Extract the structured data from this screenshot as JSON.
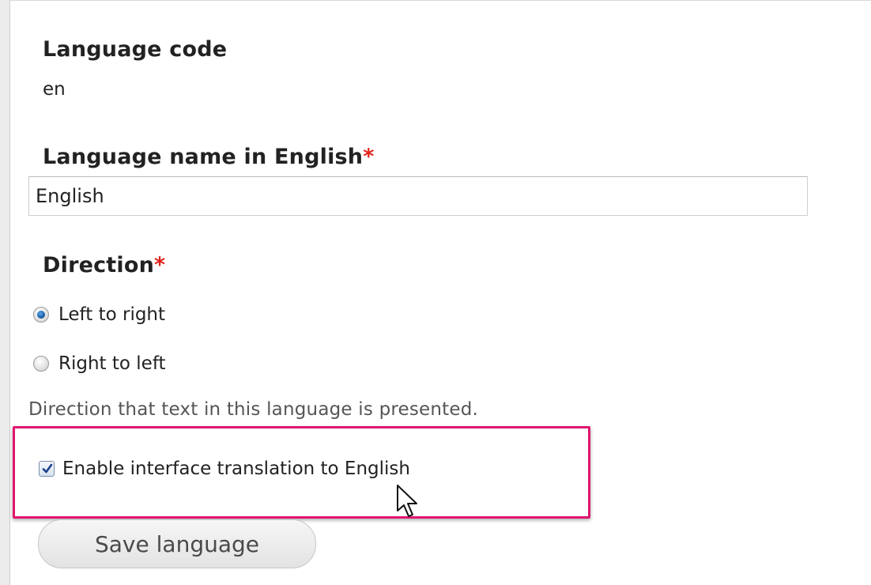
{
  "form": {
    "language_code": {
      "label": "Language code",
      "value": "en"
    },
    "language_name": {
      "label": "Language name in English",
      "required_marker": "*",
      "value": "English"
    },
    "direction": {
      "label": "Direction",
      "required_marker": "*",
      "options": [
        {
          "label": "Left to right",
          "checked": true
        },
        {
          "label": "Right to left",
          "checked": false
        }
      ],
      "description": "Direction that text in this language is presented."
    },
    "interface_translation": {
      "label": "Enable interface translation to English",
      "checked": true
    },
    "save_button": {
      "label": "Save language"
    }
  },
  "highlight": {
    "color": "#e0166f"
  },
  "icons": {
    "radio_selected": "radio-selected-icon",
    "checkbox_checked": "checkmark-icon",
    "cursor": "mouse-pointer-icon"
  }
}
